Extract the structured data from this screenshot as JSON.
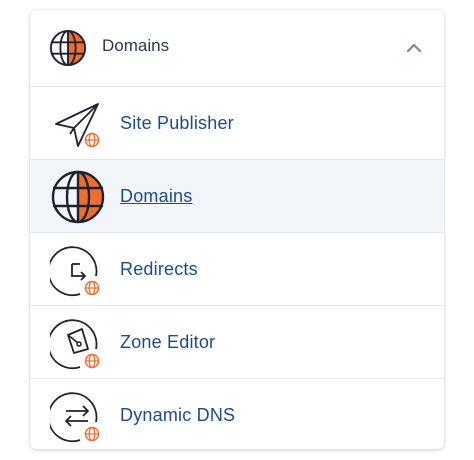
{
  "header": {
    "title": "Domains",
    "icon": "globe-icon",
    "toggle_icon": "chevron-up-icon",
    "expanded": true
  },
  "items": [
    {
      "label": "Site Publisher",
      "icon": "paper-plane-globe-icon",
      "active": false
    },
    {
      "label": "Domains",
      "icon": "globe-icon",
      "active": true
    },
    {
      "label": "Redirects",
      "icon": "redirect-arrow-globe-icon",
      "active": false
    },
    {
      "label": "Zone Editor",
      "icon": "pen-nib-globe-icon",
      "active": false
    },
    {
      "label": "Dynamic DNS",
      "icon": "exchange-arrows-globe-icon",
      "active": false
    }
  ],
  "colors": {
    "accent": "#ee6e31",
    "link": "#1e4b86",
    "active_bg": "#f2f5fa",
    "icon_stroke": "#1d2230"
  }
}
